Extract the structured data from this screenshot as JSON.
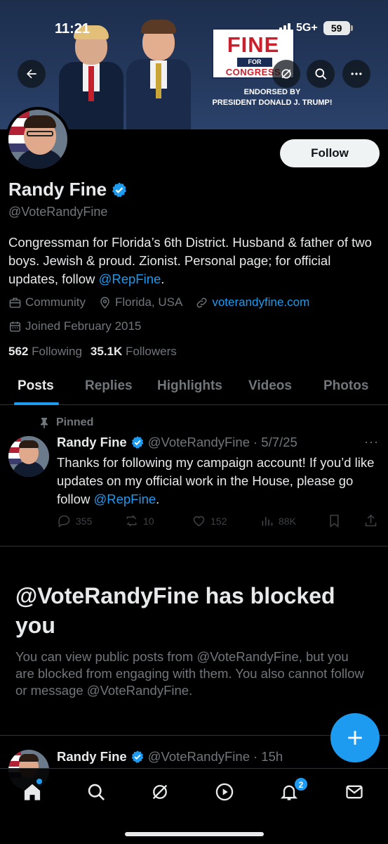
{
  "status_bar": {
    "time": "11:21",
    "network": "5G+",
    "battery": "59"
  },
  "banner": {
    "logo_main": "FINE",
    "logo_for": "FOR",
    "logo_sub": "CONGRESS",
    "endorsed_line1": "ENDORSED BY",
    "endorsed_line2": "PRESIDENT DONALD J. TRUMP!"
  },
  "profile": {
    "name": "Randy Fine",
    "handle": "@VoteRandyFine",
    "follow_label": "Follow",
    "bio_text": "Congressman for Florida’s 6th District. Husband & father of two boys. Jewish & proud. Zionist. Personal page; for official updates, follow ",
    "bio_link": "@RepFine",
    "bio_end": ".",
    "category": "Community",
    "location": "Florida, USA",
    "website": "voterandyfine.com",
    "joined": "Joined February 2015",
    "following_count": "562",
    "following_label": "Following",
    "followers_count": "35.1K",
    "followers_label": "Followers"
  },
  "tabs": [
    "Posts",
    "Replies",
    "Highlights",
    "Videos",
    "Photos"
  ],
  "pinned_post": {
    "pinned_label": "Pinned",
    "name": "Randy Fine",
    "handle": "@VoteRandyFine",
    "date": "· 5/7/25",
    "more": "···",
    "text": "Thanks for following my campaign account! If you’d like updates on my official work in the House, please go follow ",
    "link": "@RepFine",
    "text_end": ".",
    "replies": "355",
    "reposts": "10",
    "likes": "152",
    "views": "88K"
  },
  "blocked": {
    "title": "@VoteRandyFine has blocked you",
    "text": "You can view public posts from @VoteRandyFine, but you are blocked from engaging with them. You also cannot follow or message @VoteRandyFine."
  },
  "second_post": {
    "name": "Randy Fine",
    "handle": "@VoteRandyFine",
    "time": "· 15h"
  },
  "bottom_nav": {
    "items": [
      "home-icon",
      "search-icon",
      "grok-icon",
      "video-icon",
      "notifications-icon",
      "messages-icon"
    ],
    "notifications_badge": "2"
  },
  "colors": {
    "accent": "#1d9bf0",
    "background": "#000000",
    "text": "#e7e9ea",
    "muted": "#71767b"
  }
}
